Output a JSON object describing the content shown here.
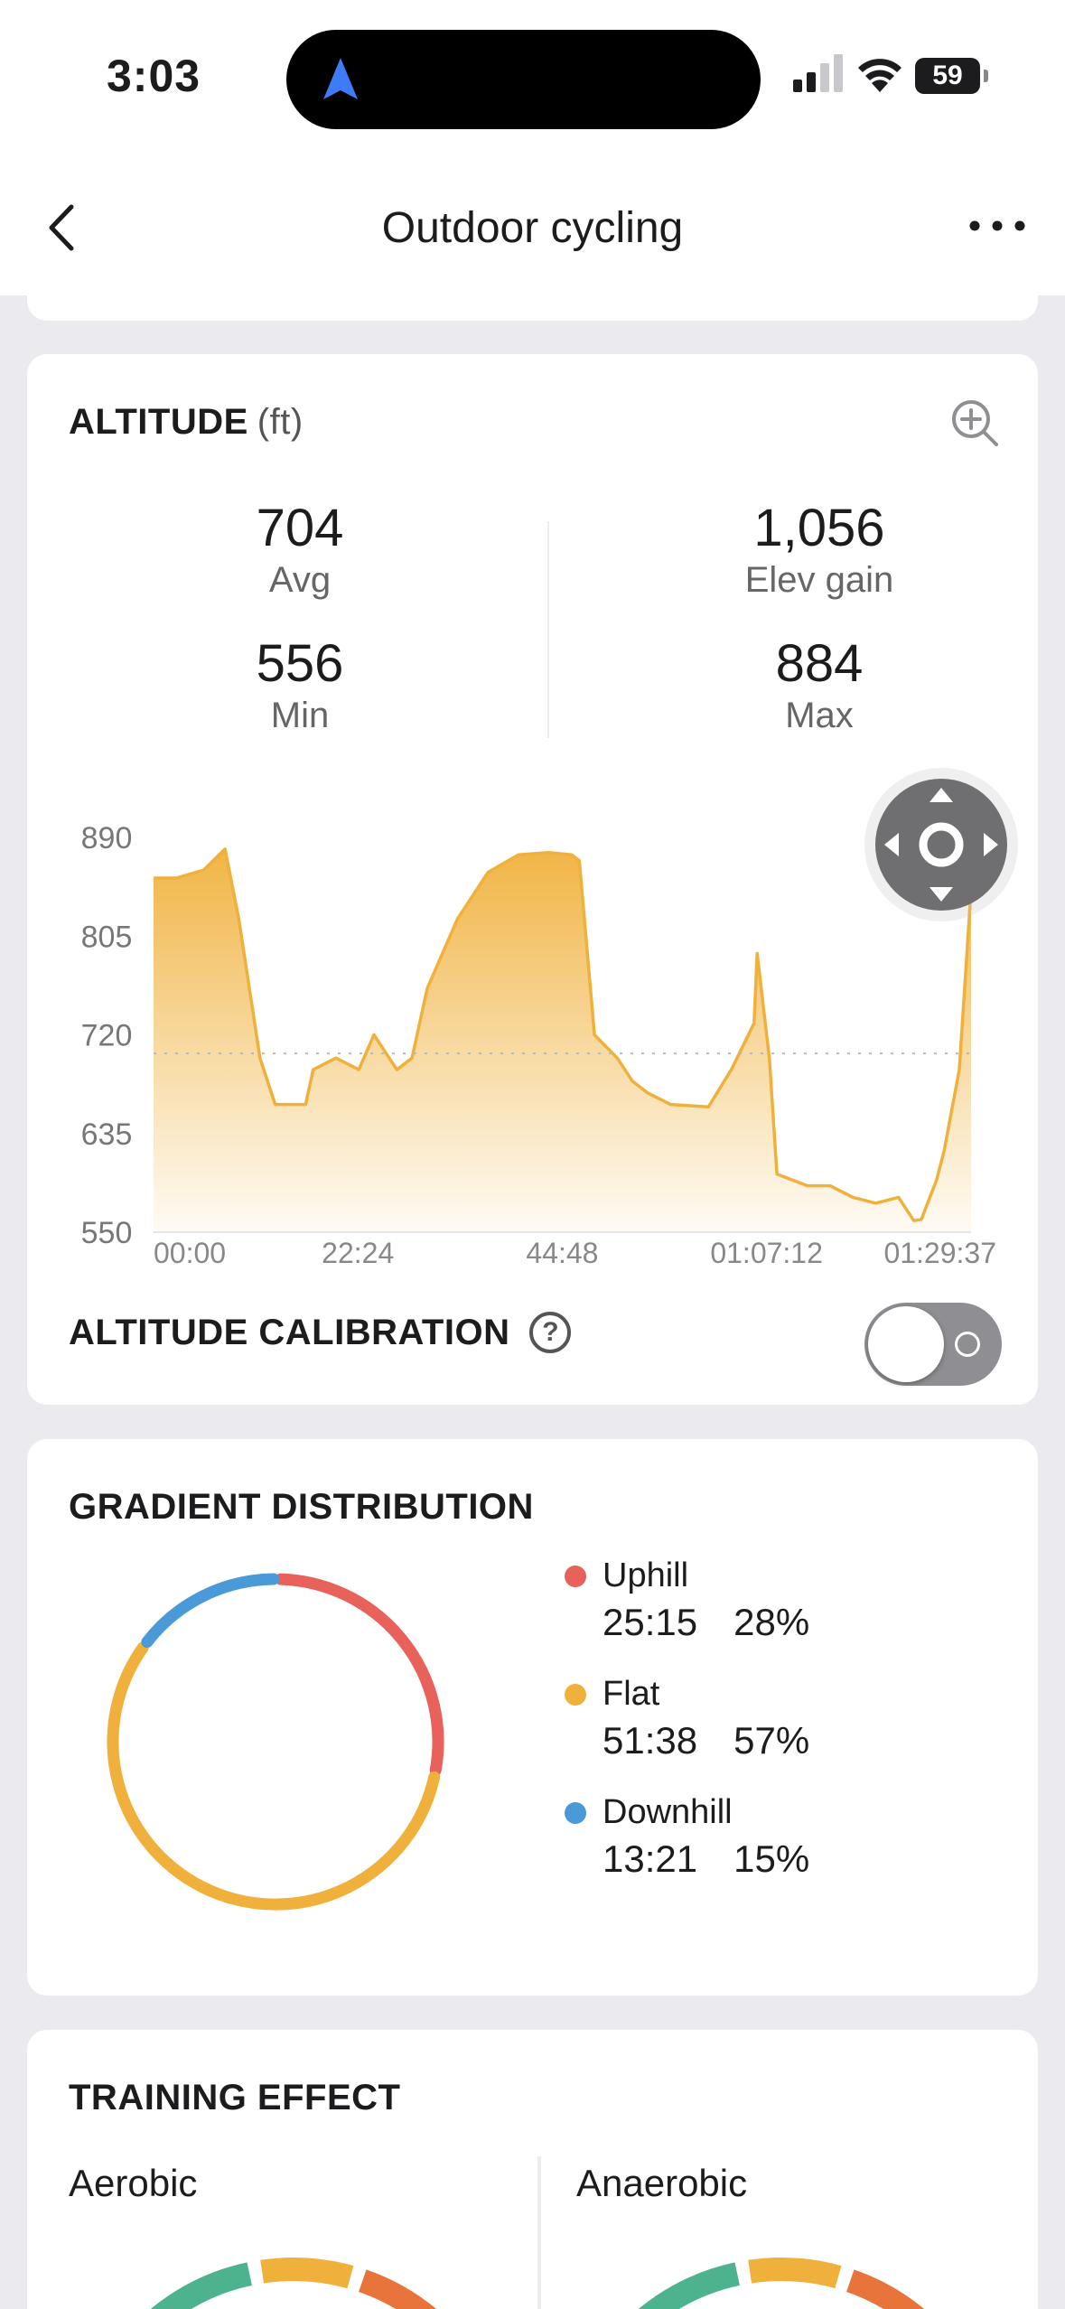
{
  "status_bar": {
    "time": "3:03",
    "battery": "59"
  },
  "header": {
    "title": "Outdoor cycling"
  },
  "altitude": {
    "title": "ALTITUDE",
    "unit": "(ft)",
    "stats": [
      {
        "value": "704",
        "label": "Avg"
      },
      {
        "value": "1,056",
        "label": "Elev gain"
      },
      {
        "value": "556",
        "label": "Min"
      },
      {
        "value": "884",
        "label": "Max"
      }
    ],
    "calibration_label": "ALTITUDE CALIBRATION",
    "help_glyph": "?",
    "calibration_enabled": false
  },
  "chart_data": {
    "type": "area",
    "y_ticks": [
      "890",
      "805",
      "720",
      "635",
      "550"
    ],
    "x_ticks": [
      "00:00",
      "22:24",
      "44:48",
      "01:07:12",
      "01:29:37"
    ],
    "ylim": [
      550,
      890
    ],
    "x_range_seconds": [
      0,
      5377
    ],
    "avg_line": 704,
    "color": "#f0b13c",
    "points": [
      [
        0,
        855
      ],
      [
        150,
        855
      ],
      [
        330,
        862
      ],
      [
        470,
        880
      ],
      [
        560,
        820
      ],
      [
        700,
        700
      ],
      [
        800,
        660
      ],
      [
        1000,
        660
      ],
      [
        1050,
        690
      ],
      [
        1200,
        700
      ],
      [
        1350,
        690
      ],
      [
        1450,
        720
      ],
      [
        1600,
        690
      ],
      [
        1700,
        700
      ],
      [
        1800,
        760
      ],
      [
        2000,
        820
      ],
      [
        2200,
        860
      ],
      [
        2400,
        875
      ],
      [
        2600,
        877
      ],
      [
        2750,
        875
      ],
      [
        2800,
        870
      ],
      [
        2900,
        720
      ],
      [
        3050,
        700
      ],
      [
        3150,
        680
      ],
      [
        3250,
        670
      ],
      [
        3400,
        660
      ],
      [
        3650,
        658
      ],
      [
        3800,
        690
      ],
      [
        3950,
        730
      ],
      [
        3970,
        790
      ],
      [
        4050,
        700
      ],
      [
        4100,
        600
      ],
      [
        4300,
        590
      ],
      [
        4450,
        590
      ],
      [
        4600,
        580
      ],
      [
        4750,
        575
      ],
      [
        4900,
        580
      ],
      [
        5000,
        560
      ],
      [
        5050,
        561
      ],
      [
        5150,
        595
      ],
      [
        5200,
        620
      ],
      [
        5300,
        690
      ],
      [
        5377,
        845
      ]
    ]
  },
  "gradient": {
    "title": "GRADIENT DISTRIBUTION",
    "items": [
      {
        "name": "Uphill",
        "time": "25:15",
        "pct": "28%",
        "fraction": 0.28,
        "color": "#e8615a"
      },
      {
        "name": "Flat",
        "time": "51:38",
        "pct": "57%",
        "fraction": 0.57,
        "color": "#f0b13c"
      },
      {
        "name": "Downhill",
        "time": "13:21",
        "pct": "15%",
        "fraction": 0.15,
        "color": "#4a9ad8"
      }
    ]
  },
  "training": {
    "title": "TRAINING EFFECT",
    "aerobic": "Aerobic",
    "anaerobic": "Anaerobic",
    "gauge_colors": [
      "#4cb38e",
      "#f0b13c",
      "#e8743c"
    ]
  }
}
